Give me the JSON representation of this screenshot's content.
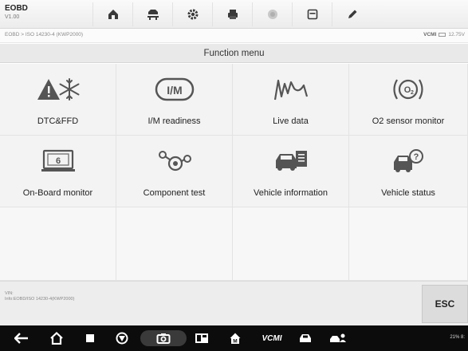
{
  "app": {
    "name": "EOBD",
    "version": "V1.00"
  },
  "toolbar": {
    "buttons": [
      {
        "id": "home",
        "icon": "home-icon"
      },
      {
        "id": "vehicle",
        "icon": "car-lift-icon"
      },
      {
        "id": "settings",
        "icon": "gear-icon"
      },
      {
        "id": "print",
        "icon": "printer-icon"
      },
      {
        "id": "help",
        "icon": "help-icon"
      },
      {
        "id": "save",
        "icon": "save-icon"
      },
      {
        "id": "edit",
        "icon": "pencil-icon"
      }
    ]
  },
  "breadcrumb": "EOBD > ISO 14230-4 (KWP2000)",
  "voltage": {
    "label": "VCMI",
    "value": "12.75V"
  },
  "menu": {
    "title": "Function menu",
    "items": [
      {
        "label": "DTC&FFD",
        "icon": "dtc-snowflake-warning-icon"
      },
      {
        "label": "I/M readiness",
        "icon": "im-readiness-icon"
      },
      {
        "label": "Live data",
        "icon": "live-data-wave-icon"
      },
      {
        "label": "O2 sensor monitor",
        "icon": "o2-sensor-icon"
      },
      {
        "label": "On-Board monitor",
        "icon": "onboard-monitor-icon"
      },
      {
        "label": "Component test",
        "icon": "component-test-icon"
      },
      {
        "label": "Vehicle information",
        "icon": "vehicle-info-icon"
      },
      {
        "label": "Vehicle status",
        "icon": "vehicle-status-icon"
      }
    ]
  },
  "info": {
    "vin_label": "VIN:",
    "protocol": "Info:EOBD/ISO 14230-4(KWP2000)"
  },
  "esc_label": "ESC",
  "navbar": {
    "vcmi_label": "VCMI",
    "status": "21% 8:"
  }
}
